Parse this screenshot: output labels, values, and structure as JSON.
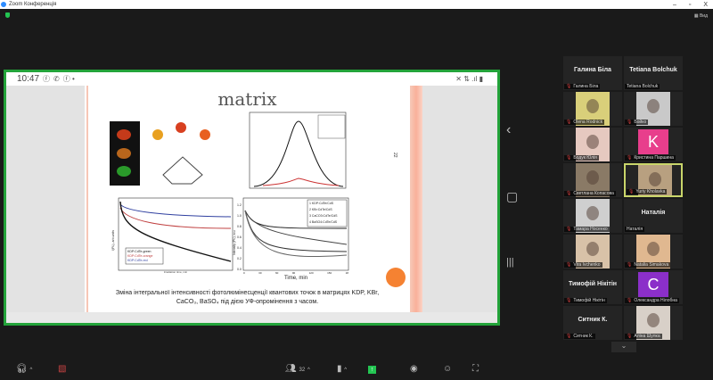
{
  "window": {
    "title": "Zoom Конференція",
    "minimize": "–",
    "maximize": "▫",
    "close": "X",
    "view_label": "Вид"
  },
  "phone_status": {
    "time": "10:47",
    "right_icons": "✕ ⇅ .ıl ▮"
  },
  "slide": {
    "title": "matrix",
    "page_number": "22",
    "left_chart": {
      "ylabel": "I(PL), arb.units",
      "xlabel": "Irradiation time, min",
      "legend": [
        "KDP:CdTe-green",
        "KDP:CdTe-orange",
        "KDP:CdTe-red"
      ]
    },
    "right_chart": {
      "xlabel": "Time, min",
      "ylabel": "Intensity (PL), a.u.",
      "legend": [
        "1 KDP:CdTe/CdS",
        "2 KBr:CdTe/CdS",
        "3 CaCO3:CdTe/CdS",
        "4 BaSO4:CdTe/CdS"
      ],
      "xticks": [
        "0",
        "30",
        "60",
        "90",
        "120",
        "150",
        "18"
      ],
      "yticks": [
        "0.0",
        "0.2",
        "0.4",
        "0.6",
        "0.8",
        "1.0",
        "1.2"
      ]
    },
    "caption_line1": "Зміна інтегральної інтенсивності фотолюмінесценції квантових точок в матрицях KDP, KBr,",
    "caption_line2": "CaCO₃, BaSO₄ під дією УФ-опромінення з часом."
  },
  "side_controls": {
    "prev": "‹",
    "home": "▢",
    "recents": "|||"
  },
  "participants": [
    {
      "name": "Галина Біла",
      "display": "Галина Біла",
      "type": "name"
    },
    {
      "name": "Tetiana Bolchuk",
      "display": "Tetiana Bolchuk",
      "type": "name",
      "muted": false
    },
    {
      "name": "Olena Rodnick",
      "type": "video",
      "bg": "#d9cf7a"
    },
    {
      "name": "Бойко",
      "type": "video",
      "bg": "#c9c9c9"
    },
    {
      "name": "Бодук Юлія",
      "type": "video",
      "bg": "#e6c9c0"
    },
    {
      "name": "Кристина Паршина",
      "type": "avatar",
      "letter": "K",
      "color": "#e83e8c"
    },
    {
      "name": "Светлана Копасова",
      "type": "video",
      "bg": "#8a7a66"
    },
    {
      "name": "Yuriy Kholavka",
      "type": "video",
      "bg": "#b8a080",
      "active": true
    },
    {
      "name": "Тамара Носенко",
      "type": "video",
      "bg": "#cfcfcf"
    },
    {
      "name": "Наталія",
      "display": "Наталія",
      "type": "name",
      "muted": false
    },
    {
      "name": "Vira Ivchenko",
      "type": "video",
      "bg": "#d8c2a8"
    },
    {
      "name": "Natalia Simakova",
      "type": "video",
      "bg": "#e0b890"
    },
    {
      "name": "Тимофій Нікітін",
      "display": "Тимофій Нікітін",
      "type": "name"
    },
    {
      "name": "Олександра Нілобна",
      "type": "avatar",
      "letter": "C",
      "color": "#8b2fc9"
    },
    {
      "name": "Ситник К.",
      "display": "Ситник К.",
      "type": "name"
    },
    {
      "name": "Аліна Шулка",
      "type": "video",
      "bg": "#d8d0c8"
    }
  ],
  "toolbar": {
    "participants_count": "32",
    "more": "⌄"
  }
}
